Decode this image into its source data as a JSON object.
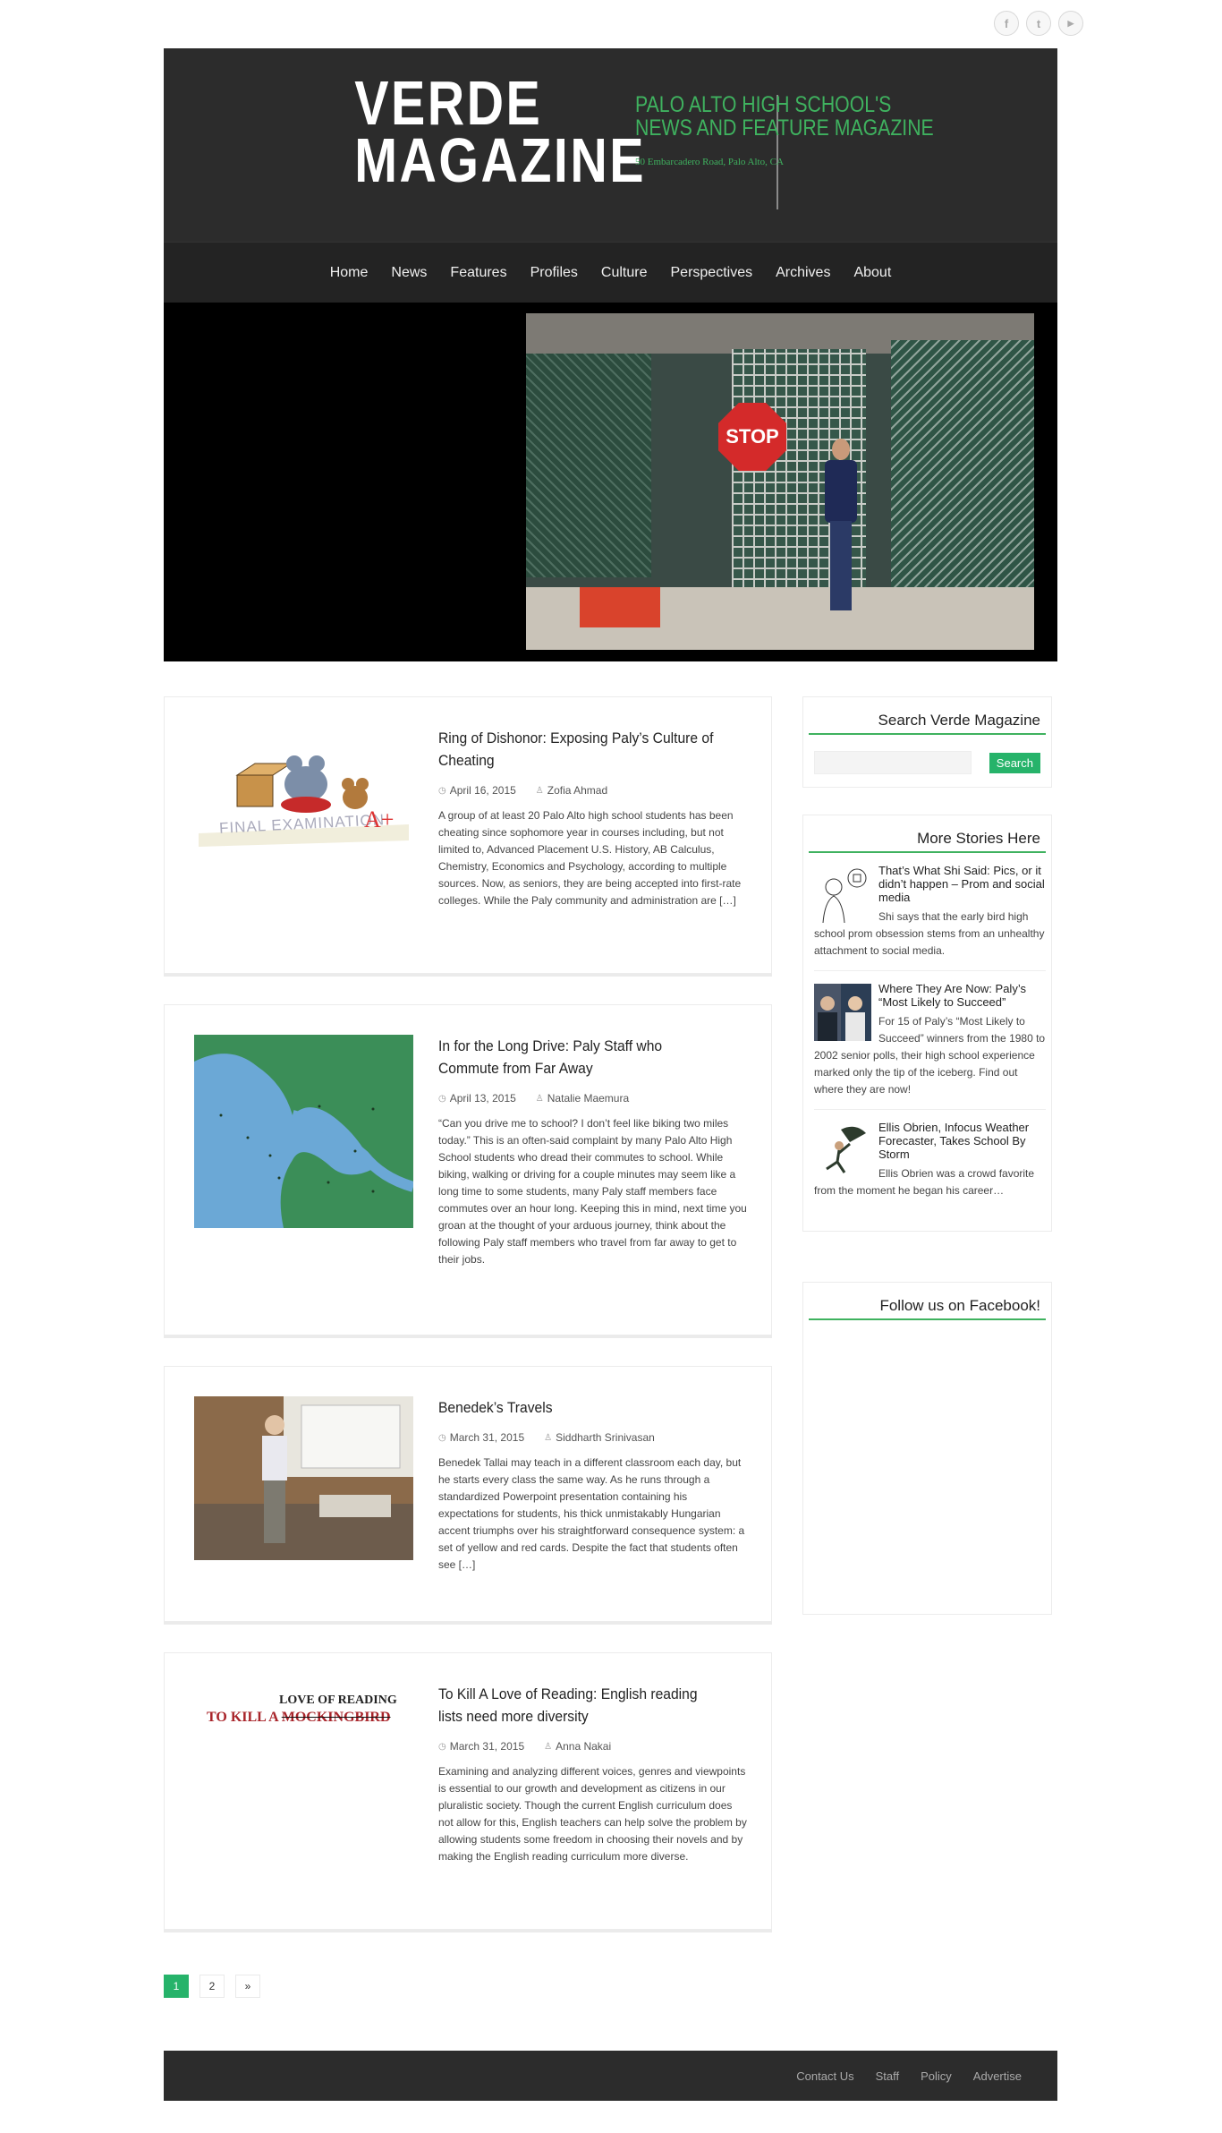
{
  "social": [
    {
      "icon": "facebook-icon",
      "glyph": "f"
    },
    {
      "icon": "twitter-icon",
      "glyph": "t"
    },
    {
      "icon": "youtube-icon",
      "glyph": "▶"
    }
  ],
  "header": {
    "logo_line1": "VERDE",
    "logo_line2": "MAGAZINE",
    "tagline_line1": "PALO ALTO HIGH SCHOOL'S",
    "tagline_line2": "NEWS AND FEATURE MAGAZINE",
    "address": "50 Embarcadero Road, Palo Alto, CA"
  },
  "nav": [
    "Home",
    "News",
    "Features",
    "Profiles",
    "Culture",
    "Perspectives",
    "Archives",
    "About"
  ],
  "slider": {
    "sign_text": "STOP"
  },
  "posts": [
    {
      "title": "Ring of Dishonor: Exposing Paly’s Culture of Cheating",
      "date": "April 16, 2015",
      "author": "Zofia Ahmad",
      "excerpt": "A group of at least 20 Palo Alto high school students has been cheating since sophomore year in courses including, but not limited to, Advanced Placement U.S. History, AB Calculus, Chemistry, Economics and Psychology, according to multiple sources. Now, as seniors, they are being accepted into first-rate colleges. While the Paly community and administration are […]",
      "thumb_text": "FINAL EXAMINATION",
      "thumb_grade": "A+"
    },
    {
      "title": "In for the Long Drive: Paly Staff who Commute from Far Away",
      "date": "April 13, 2015",
      "author": "Natalie Maemura",
      "excerpt": "“Can you drive me to school? I don’t feel like biking two miles today.” This is an often-said complaint by many Palo Alto High School students who dread their commutes to school. While biking, walking or driving for a couple minutes may seem like a long time to some students, many Paly staff members face commutes over an hour long. Keeping this in mind, next time you groan at the thought of your arduous journey, think about the following Paly staff members who travel from far away to get to their jobs."
    },
    {
      "title": "Benedek’s Travels",
      "date": "March 31, 2015",
      "author": "Siddharth Srinivasan",
      "excerpt": "Benedek Tallai may teach in a different classroom each day, but he starts every class the same way. As he runs through a standardized Powerpoint presentation containing his expectations for students, his thick unmistakably Hungarian accent triumphs over his straightforward consequence system: a set of yellow and red cards. Despite the fact that students often see […]"
    },
    {
      "title": "To Kill A Love of Reading: English reading lists need more diversity",
      "date": "March 31, 2015",
      "author": "Anna Nakai",
      "excerpt": "Examining and analyzing different voices, genres and viewpoints is essential to our growth and development as citizens in our pluralistic society. Though the current English curriculum does not allow for this, English teachers can help solve the problem by allowing students some freedom in choosing their novels and by making the English reading curriculum more diverse.",
      "thumb_line1": "TO KILL A",
      "thumb_strike": "MOCKINGBIRD",
      "thumb_overline": "LOVE OF READING"
    }
  ],
  "sidebar": {
    "search_title": "Search Verde Magazine",
    "search_button": "Search",
    "more_title": "More Stories Here",
    "stories": [
      {
        "title": "That’s What Shi Said: Pics, or it didn’t happen – Prom and social media",
        "excerpt": "Shi says that the early bird high school prom obsession stems from an unhealthy attachment to social media."
      },
      {
        "title": "Where They Are Now: Paly’s “Most Likely to Succeed”",
        "excerpt": "For 15 of Paly’s “Most Likely to Succeed” winners from the 1980 to 2002 senior polls, their high school experience marked only the tip of the iceberg. Find out where they are now!"
      },
      {
        "title": "Ellis Obrien, Infocus Weather Forecaster, Takes School By Storm",
        "excerpt": "Ellis Obrien was a crowd favorite from the moment he began his career…"
      }
    ],
    "facebook_title": "Follow us on Facebook!"
  },
  "pagination": [
    "1",
    "2",
    "»"
  ],
  "footer": [
    "Contact Us",
    "Staff",
    "Policy",
    "Advertise"
  ],
  "colors": {
    "accent": "#26b36a",
    "tagline": "#3fb25f",
    "header_bg": "#2c2c2c"
  }
}
